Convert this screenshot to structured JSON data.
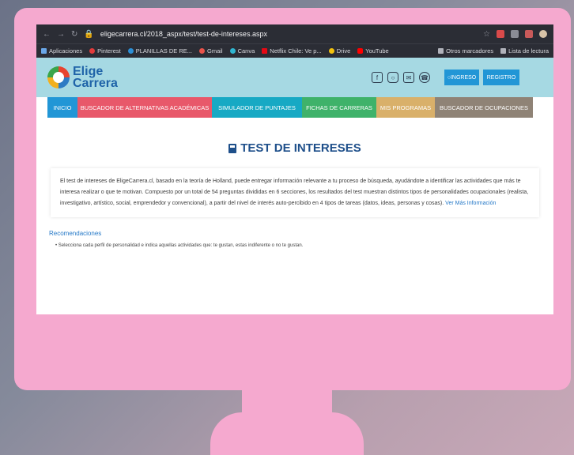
{
  "browser": {
    "url": "eligecarrera.cl/2018_aspx/test/test-de-intereses.aspx",
    "bookmarks": [
      {
        "label": "Aplicaciones",
        "color": "#6aa7e8"
      },
      {
        "label": "Pinterest",
        "color": "#e23b3b"
      },
      {
        "label": "PLANILLAS DE RE...",
        "color": "#2c8fd6"
      },
      {
        "label": "Gmail",
        "color": "#e9534a"
      },
      {
        "label": "Canva",
        "color": "#2fb6d1"
      },
      {
        "label": "Netflix Chile: Ve p...",
        "color": "#e50914"
      },
      {
        "label": "Drive",
        "color": "#f4c20d"
      },
      {
        "label": "YouTube",
        "color": "#ff0000"
      }
    ],
    "bookmarks_right": [
      "Otros marcadores",
      "Lista de lectura"
    ]
  },
  "site": {
    "logo_line1": "Elige",
    "logo_line2": "Carrera",
    "social_icons": [
      "facebook-icon",
      "instagram-icon",
      "mail-icon",
      "whatsapp-icon"
    ],
    "login_label": "INGRESO",
    "register_label": "REGISTRO"
  },
  "menu": [
    {
      "label": "INICIO",
      "color": "#2196d6"
    },
    {
      "label": "BUSCADOR DE ALTERNATIVAS ACADÉMICAS",
      "color": "#e8586a"
    },
    {
      "label": "SIMULADOR DE PUNTAJES",
      "color": "#17a9c4"
    },
    {
      "label": "FICHAS DE CARRERAS",
      "color": "#3fb26a"
    },
    {
      "label": "MIS PROGRAMAS",
      "color": "#d9b06a"
    },
    {
      "label": "BUSCADOR DE OCUPACIONES",
      "color": "#8f8376"
    }
  ],
  "page": {
    "title": "TEST DE INTERESES",
    "intro": "El test de intereses de EligeCarrera.cl, basado en la teoría de Holland, puede entregar información relevante a tu proceso de búsqueda, ayudándote a identificar las actividades que más te interesa realizar o que te motivan. Compuesto por un total de 54 preguntas divididas en 6 secciones, los resultados del test muestran distintos tipos de personalidades ocupacionales (realista, investigativo, artístico, social, emprendedor y convencional), a partir del nivel de interés auto-percibido en 4 tipos de tareas (datos, ideas, personas y cosas).",
    "more_info_link": "Ver Más Información",
    "recommendations_title": "Recomendaciones",
    "recommendations": [
      "Selecciona cada perfil de personalidad e indica aquellas actividades que: te gustan, estas indiferente o no te gustan."
    ]
  }
}
